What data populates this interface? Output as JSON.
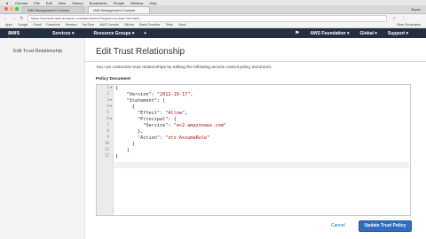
{
  "browser": {
    "menu": [
      "Chrome",
      "File",
      "Edit",
      "View",
      "History",
      "Bookmarks",
      "People",
      "Window",
      "Help"
    ],
    "tabs": [
      "IAM Management Console",
      "IAM Management Console"
    ],
    "user": "Bryan",
    "url": "https://console.aws.amazon.com/iam/home?region=us-east-1#/roles/...",
    "bookmarks": [
      "Apps",
      "Google",
      "Gmail",
      "Facebook",
      "Mentors",
      "YouTube",
      "AWS Console",
      "GitHub",
      "Stack Overflow",
      "Trello",
      "Slack",
      "Other Bookmarks"
    ]
  },
  "aws_nav": {
    "logo": "aws",
    "services": "Services",
    "resource_groups": "Resource Groups",
    "account": "AWS Foundation",
    "region": "Global",
    "support": "Support"
  },
  "sidebar": {
    "items": [
      {
        "label": "Edit Trust Relationship"
      }
    ]
  },
  "main": {
    "title": "Edit Trust Relationship",
    "description": "You can customize trust relationships by editing the following access control policy document.",
    "policy_label": "Policy Document",
    "line_numbers": [
      "1",
      "2",
      "3",
      "4",
      "5",
      "6",
      "7",
      "8",
      "9",
      "10",
      "11",
      "12"
    ],
    "code": {
      "l1": "{",
      "l2_key": "\"Version\"",
      "l2_val": "\"2012-10-17\"",
      "l3_key": "\"Statement\"",
      "l3_rest": ": [",
      "l4": "{",
      "l5_key": "\"Effect\"",
      "l5_val": "\"Allow\"",
      "l6_key": "\"Principal\"",
      "l6_rest": ": {",
      "l7_key": "\"Service\"",
      "l7_val": "\"ec2.amazonaws.com\"",
      "l8": "},",
      "l9_key": "\"Action\"",
      "l9_val": "\"sts:AssumeRole\"",
      "l10": "}",
      "l11": "]",
      "l12": "}"
    },
    "cancel_label": "Cancel",
    "update_label": "Update Trust Policy"
  },
  "colors": {
    "aws_nav_bg": "#232f3e",
    "aws_accent": "#ff9900",
    "primary_button": "#2e6ebf",
    "link": "#0073bb",
    "string": "#a31515"
  }
}
